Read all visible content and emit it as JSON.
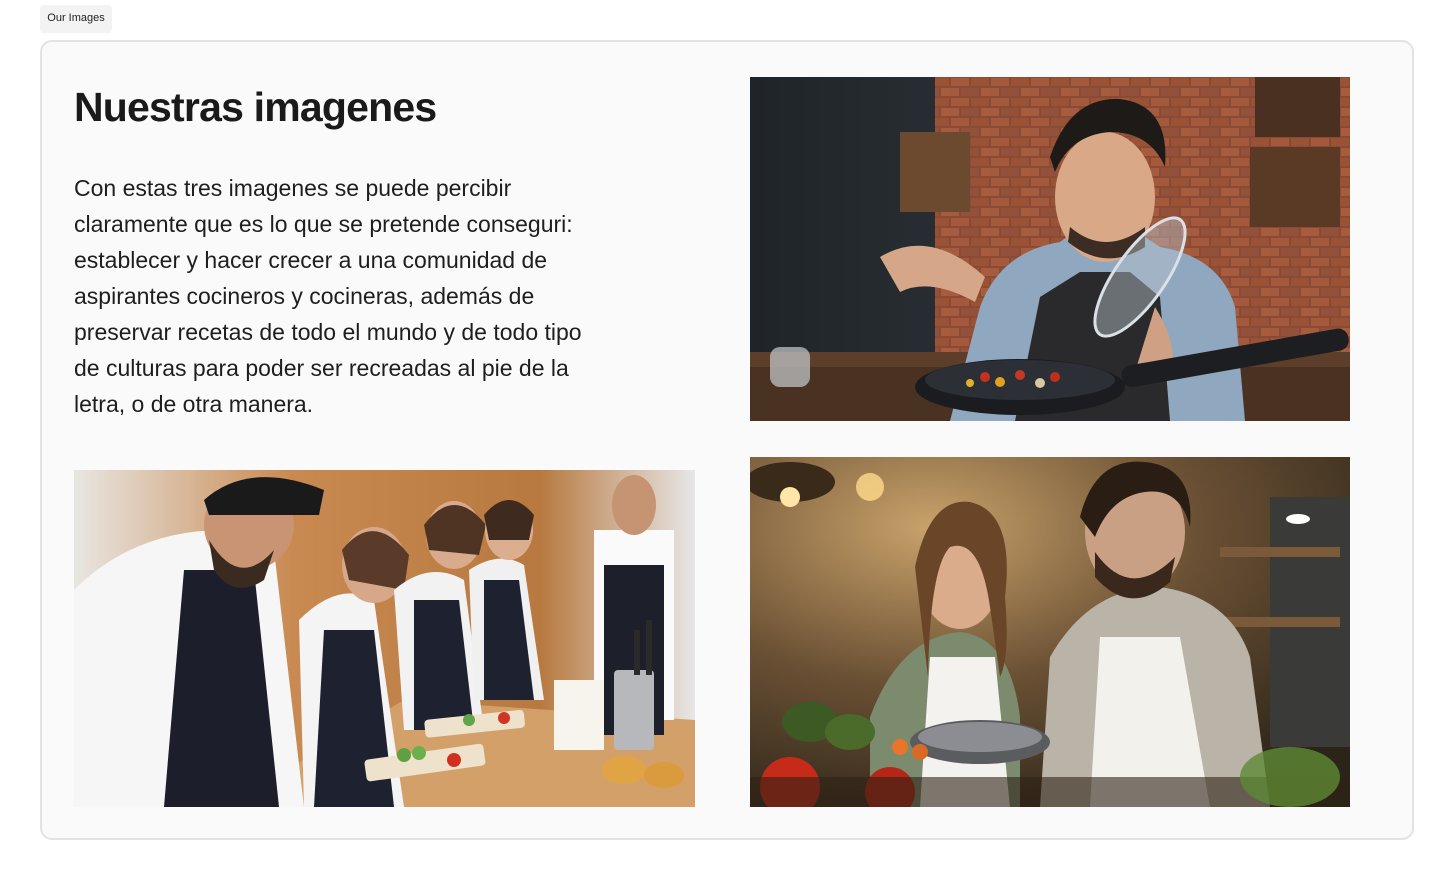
{
  "tab": {
    "label": "Our Images"
  },
  "section": {
    "title": "Nuestras imagenes",
    "description": "Con estas tres imagenes se puede percibir claramente que es lo que se pretende conseguri: establecer y hacer crecer a una comunidad de aspirantes cocineros y cocineras, además de preservar recetas de todo el mundo y de todo tipo de culturas para poder ser recreadas al pie de la letra, o de otra manera."
  },
  "images": [
    {
      "subject": "chef seasoning a frying pan in a brick kitchen"
    },
    {
      "subject": "cooking class students chopping vegetables"
    },
    {
      "subject": "smiling couple cooking together in a warm kitchen"
    }
  ]
}
